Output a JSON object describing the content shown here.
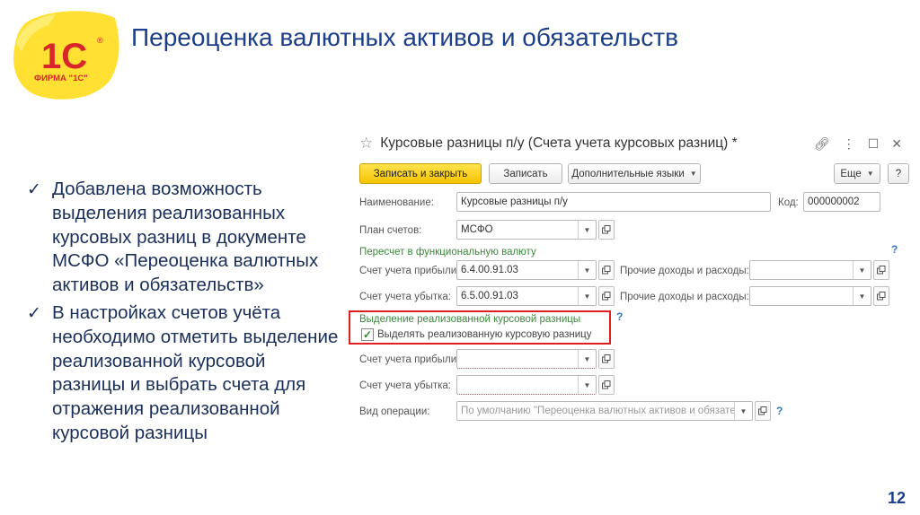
{
  "logo": {
    "text": "1С",
    "subtitle": "ФИРМА \"1С\"",
    "registered": "®"
  },
  "slide": {
    "title": "Переоценка валютных активов и обязательств",
    "page": "12"
  },
  "bullets": [
    {
      "text": "Добавлена возможность выделения реализованных курсовых разниц в документе МСФО «Переоценка валютных активов и обязательств»"
    },
    {
      "text": "В настройках счетов учёта необходимо отметить выделение реализованной курсовой разницы и выбрать счета для отражения реализованной курсовой разницы"
    }
  ],
  "form": {
    "title": "Курсовые разницы п/у (Счета учета курсовых разниц) *",
    "toolbar": {
      "save_close": "Записать и закрыть",
      "save": "Записать",
      "languages": "Дополнительные языки",
      "more": "Еще",
      "help": "?"
    },
    "name": {
      "label": "Наименование:",
      "value": "Курсовые разницы п/у"
    },
    "code": {
      "label": "Код:",
      "value": "000000002"
    },
    "plan": {
      "label": "План счетов:",
      "value": "МСФО"
    },
    "recalc_group": "Пересчет в функциональную валюту",
    "profit": {
      "label": "Счет учета прибыли:",
      "value": "6.4.00.91.03"
    },
    "loss": {
      "label": "Счет учета убытка:",
      "value": "6.5.00.91.03"
    },
    "other1": {
      "label": "Прочие доходы и расходы:",
      "value": ""
    },
    "other2": {
      "label": "Прочие доходы и расходы:",
      "value": ""
    },
    "realized_group": "Выделение реализованной курсовой разницы",
    "realized_checkbox": {
      "label": "Выделять реализованную курсовую разницу",
      "checked": true
    },
    "profit2": {
      "label": "Счет учета прибыли:",
      "value": ""
    },
    "loss2": {
      "label": "Счет учета убытка:",
      "value": ""
    },
    "operation": {
      "label": "Вид операции:",
      "placeholder": "По умолчанию \"Переоценка валютных активов и обязател"
    },
    "help_mark": "?"
  }
}
